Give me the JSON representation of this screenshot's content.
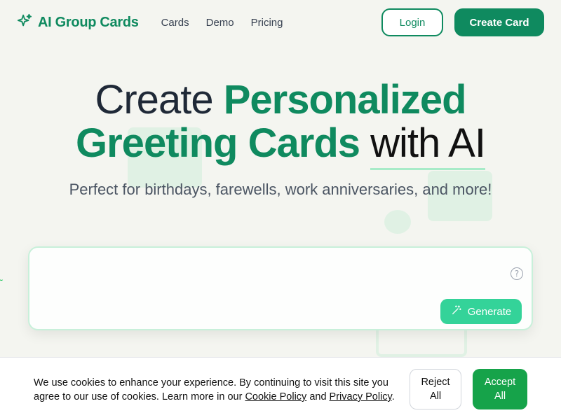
{
  "header": {
    "logo_text": "AI Group Cards",
    "nav": [
      "Cards",
      "Demo",
      "Pricing"
    ],
    "login_label": "Login",
    "create_label": "Create Card"
  },
  "hero": {
    "title_part1": "Create",
    "title_part2": "Personalized",
    "title_part3": "Greeting Cards",
    "title_part4": "with AI",
    "subtitle": "Perfect for birthdays, farewells, work anniversaries, and more!"
  },
  "prompt": {
    "value": "",
    "generate_label": "Generate",
    "help_glyph": "?"
  },
  "cookie": {
    "text_before": "We use cookies to enhance your experience. By continuing to visit this site you agree to our use of cookies. Learn more in our ",
    "cookie_policy": "Cookie Policy",
    "and": " and ",
    "privacy_policy": "Privacy Policy",
    "period": ".",
    "reject_line1": "Reject",
    "reject_line2": "All",
    "accept_line1": "Accept",
    "accept_line2": "All"
  },
  "colors": {
    "brand": "#0f8a5f",
    "generate": "#34d399",
    "accept": "#16a34a"
  },
  "icons": [
    "sparkle-icon",
    "help-icon",
    "magic-wand-icon"
  ]
}
